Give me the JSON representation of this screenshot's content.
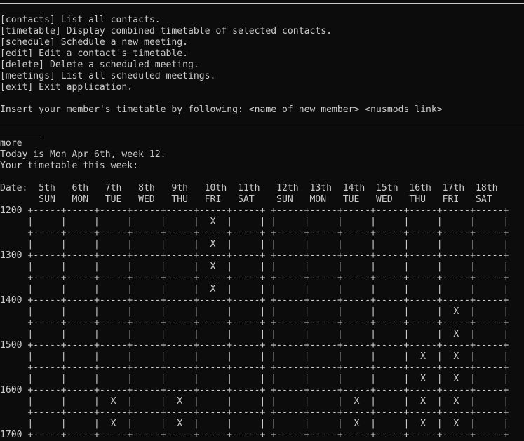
{
  "menu": [
    "[contacts] List all contacts.",
    "[timetable] Display combined timetable of selected contacts.",
    "[schedule] Schedule a new meeting.",
    "[edit] Edit a contact's timetable.",
    "[delete] Delete a scheduled meeting.",
    "[meetings] List all scheduled meetings.",
    "[exit] Exit application."
  ],
  "prompt": "Insert your member's timetable by following: <name of new member> <nusmods link>",
  "command": "more",
  "today": "Today is Mon Apr 6th, week 12.",
  "timetable_heading": "Your timetable this week:",
  "date_header": "Date:  5th   6th   7th   8th   9th   10th  11th   12th  13th  14th  15th  16th  17th  18th",
  "day_header": "       SUN   MON   TUE   WED   THU   FRI   SAT    SUN   MON   TUE   WED   THU   FRI   SAT",
  "grid_lines": [
    "1200 +-----+-----+-----+-----+-----+-----+-----+ +-----+-----+-----+-----+-----+-----+-----+",
    "     |     |     |     |     |     |  X  |     | |     |     |     |     |     |     |     |",
    "     +-----+-----+-----+-----+-----+-----+-----+ +-----+-----+-----+-----+-----+-----+-----+",
    "     |     |     |     |     |     |  X  |     | |     |     |     |     |     |     |     |",
    "1300 +-----+-----+-----+-----+-----+-----+-----+ +-----+-----+-----+-----+-----+-----+-----+",
    "     |     |     |     |     |     |  X  |     | |     |     |     |     |     |     |     |",
    "     +-----+-----+-----+-----+-----+-----+-----+ +-----+-----+-----+-----+-----+-----+-----+",
    "     |     |     |     |     |     |  X  |     | |     |     |     |     |     |     |     |",
    "1400 +-----+-----+-----+-----+-----+-----+-----+ +-----+-----+-----+-----+-----+-----+-----+",
    "     |     |     |     |     |     |     |     | |     |     |     |     |     |  X  |     |",
    "     +-----+-----+-----+-----+-----+-----+-----+ +-----+-----+-----+-----+-----+-----+-----+",
    "     |     |     |     |     |     |     |     | |     |     |     |     |     |  X  |     |",
    "1500 +-----+-----+-----+-----+-----+-----+-----+ +-----+-----+-----+-----+-----+-----+-----+",
    "     |     |     |     |     |     |     |     | |     |     |     |     |  X  |  X  |     |",
    "     +-----+-----+-----+-----+-----+-----+-----+ +-----+-----+-----+-----+-----+-----+-----+",
    "     |     |     |     |     |     |     |     | |     |     |     |     |  X  |  X  |     |",
    "1600 +-----+-----+-----+-----+-----+-----+-----+ +-----+-----+-----+-----+-----+-----+-----+",
    "     |     |     |  X  |     |  X  |     |     | |     |     |  X  |     |  X  |  X  |     |",
    "     +-----+-----+-----+-----+-----+-----+-----+ +-----+-----+-----+-----+-----+-----+-----+",
    "     |     |     |  X  |     |  X  |     |     | |     |     |  X  |     |  X  |  X  |     |",
    "1700 +-----+-----+-----+-----+-----+-----+-----+ +-----+-----+-----+-----+-----+-----+-----+"
  ]
}
